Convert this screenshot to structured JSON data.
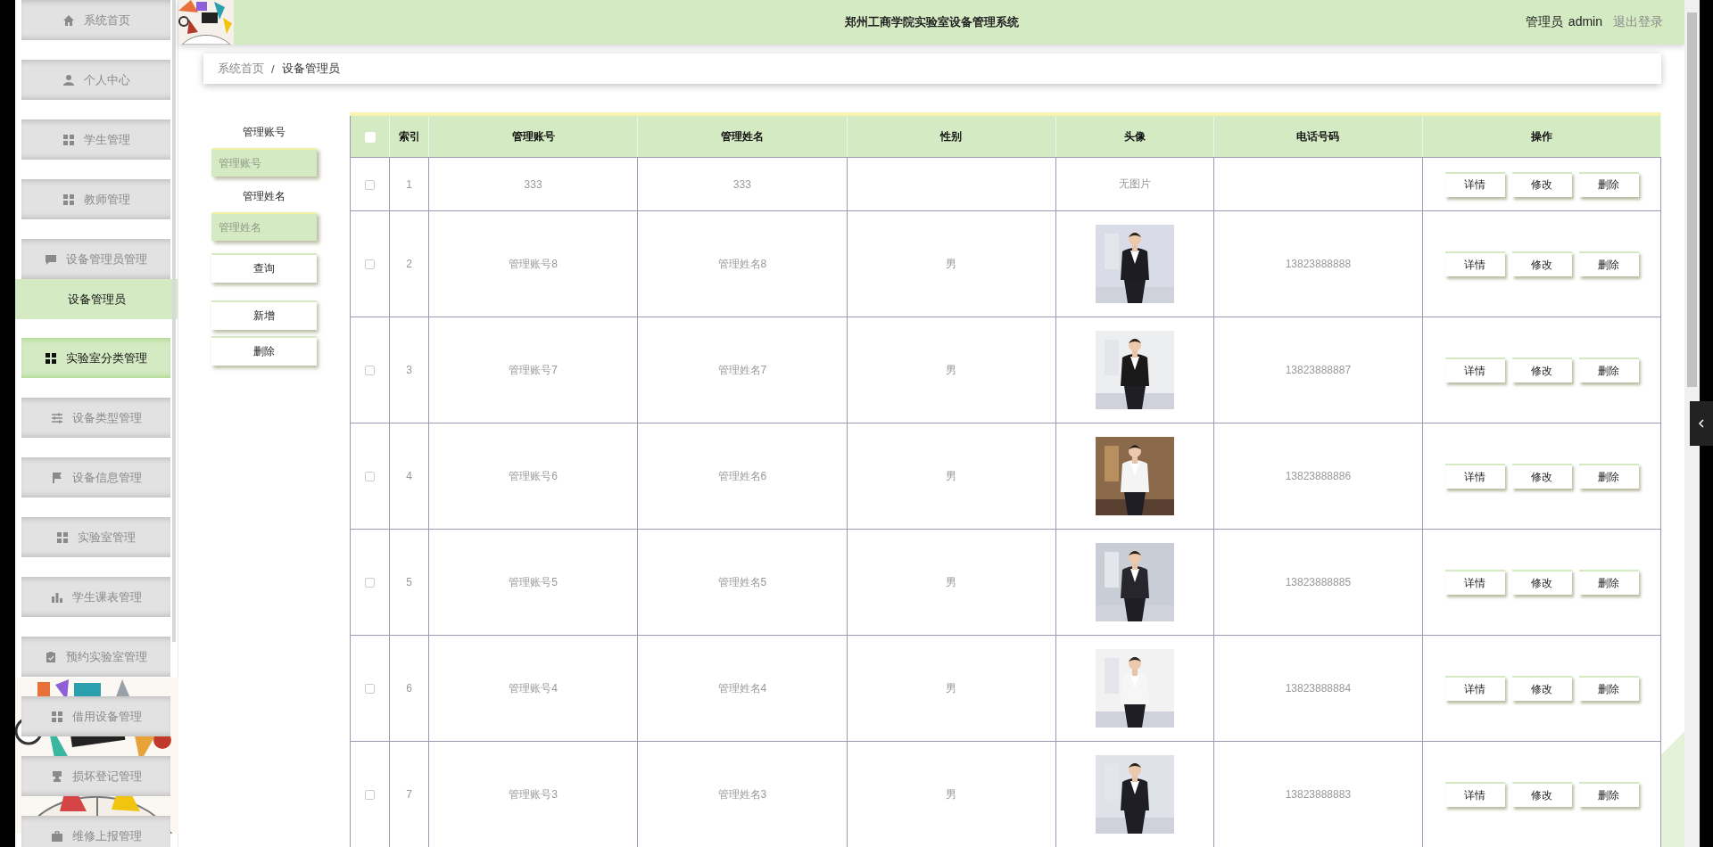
{
  "header": {
    "title": "郑州工商学院实验室设备管理系统",
    "user_role": "管理员",
    "user_name": "admin",
    "logout": "退出登录"
  },
  "sidebar": {
    "items": [
      {
        "label": "系统首页",
        "kind": "home",
        "expanded": false,
        "highlighted": false
      },
      {
        "label": "个人中心",
        "kind": "person",
        "expanded": false,
        "highlighted": false
      },
      {
        "label": "学生管理",
        "kind": "grid",
        "expanded": false,
        "highlighted": false
      },
      {
        "label": "教师管理",
        "kind": "grid",
        "expanded": false,
        "highlighted": false
      },
      {
        "label": "设备管理员管理",
        "kind": "chat",
        "expanded": true,
        "highlighted": false,
        "children": [
          {
            "label": "设备管理员",
            "selected": true
          }
        ]
      },
      {
        "label": "实验室分类管理",
        "kind": "grid",
        "expanded": false,
        "highlighted": true
      },
      {
        "label": "设备类型管理",
        "kind": "sliders",
        "expanded": false,
        "highlighted": false
      },
      {
        "label": "设备信息管理",
        "kind": "flag",
        "expanded": false,
        "highlighted": false
      },
      {
        "label": "实验室管理",
        "kind": "grid",
        "expanded": false,
        "highlighted": false
      },
      {
        "label": "学生课表管理",
        "kind": "bars",
        "expanded": false,
        "highlighted": false
      },
      {
        "label": "预约实验室管理",
        "kind": "clipboard",
        "expanded": false,
        "highlighted": false
      },
      {
        "label": "借用设备管理",
        "kind": "grid",
        "expanded": false,
        "highlighted": false
      },
      {
        "label": "损坏登记管理",
        "kind": "stamp",
        "expanded": false,
        "highlighted": false
      },
      {
        "label": "维修上报管理",
        "kind": "briefcase",
        "expanded": false,
        "highlighted": false
      }
    ]
  },
  "breadcrumb": {
    "separator": "/",
    "items": [
      "系统首页",
      "设备管理员"
    ]
  },
  "search": {
    "fields": [
      {
        "label": "管理账号",
        "placeholder": "管理账号"
      },
      {
        "label": "管理姓名",
        "placeholder": "管理姓名"
      }
    ],
    "buttons": [
      "查询",
      "新增",
      "删除"
    ]
  },
  "table": {
    "select_all_checked": false,
    "columns": [
      "索引",
      "管理账号",
      "管理姓名",
      "性别",
      "头像",
      "电话号码",
      "操作"
    ],
    "rows": [
      {
        "checked": false,
        "index": "1",
        "account": "333",
        "name": "333",
        "avatar": {
          "kind": "text",
          "text": "无图片"
        },
        "actions": [
          "详情",
          "修改",
          "删除"
        ]
      },
      {
        "checked": false,
        "index": "2",
        "account": "管理账号8",
        "name": "管理姓名8",
        "gender": "男",
        "phone": "13823888888",
        "actions": [
          "详情",
          "修改",
          "删除"
        ]
      },
      {
        "checked": false,
        "index": "3",
        "account": "管理账号7",
        "name": "管理姓名7",
        "gender": "男",
        "phone": "13823888887",
        "actions": [
          "详情",
          "修改",
          "删除"
        ]
      },
      {
        "checked": false,
        "index": "4",
        "account": "管理账号6",
        "name": "管理姓名6",
        "gender": "男",
        "phone": "13823888886",
        "actions": [
          "详情",
          "修改",
          "删除"
        ]
      },
      {
        "checked": false,
        "index": "5",
        "account": "管理账号5",
        "name": "管理姓名5",
        "gender": "男",
        "phone": "13823888885",
        "actions": [
          "详情",
          "修改",
          "删除"
        ]
      },
      {
        "checked": false,
        "index": "6",
        "account": "管理账号4",
        "name": "管理姓名4",
        "gender": "男",
        "phone": "13823888884",
        "actions": [
          "详情",
          "修改",
          "删除"
        ]
      },
      {
        "checked": false,
        "index": "7",
        "account": "管理账号3",
        "name": "管理姓名3",
        "gender": "男",
        "phone": "13823888883",
        "actions": [
          "详情",
          "修改",
          "删除"
        ]
      }
    ]
  }
}
